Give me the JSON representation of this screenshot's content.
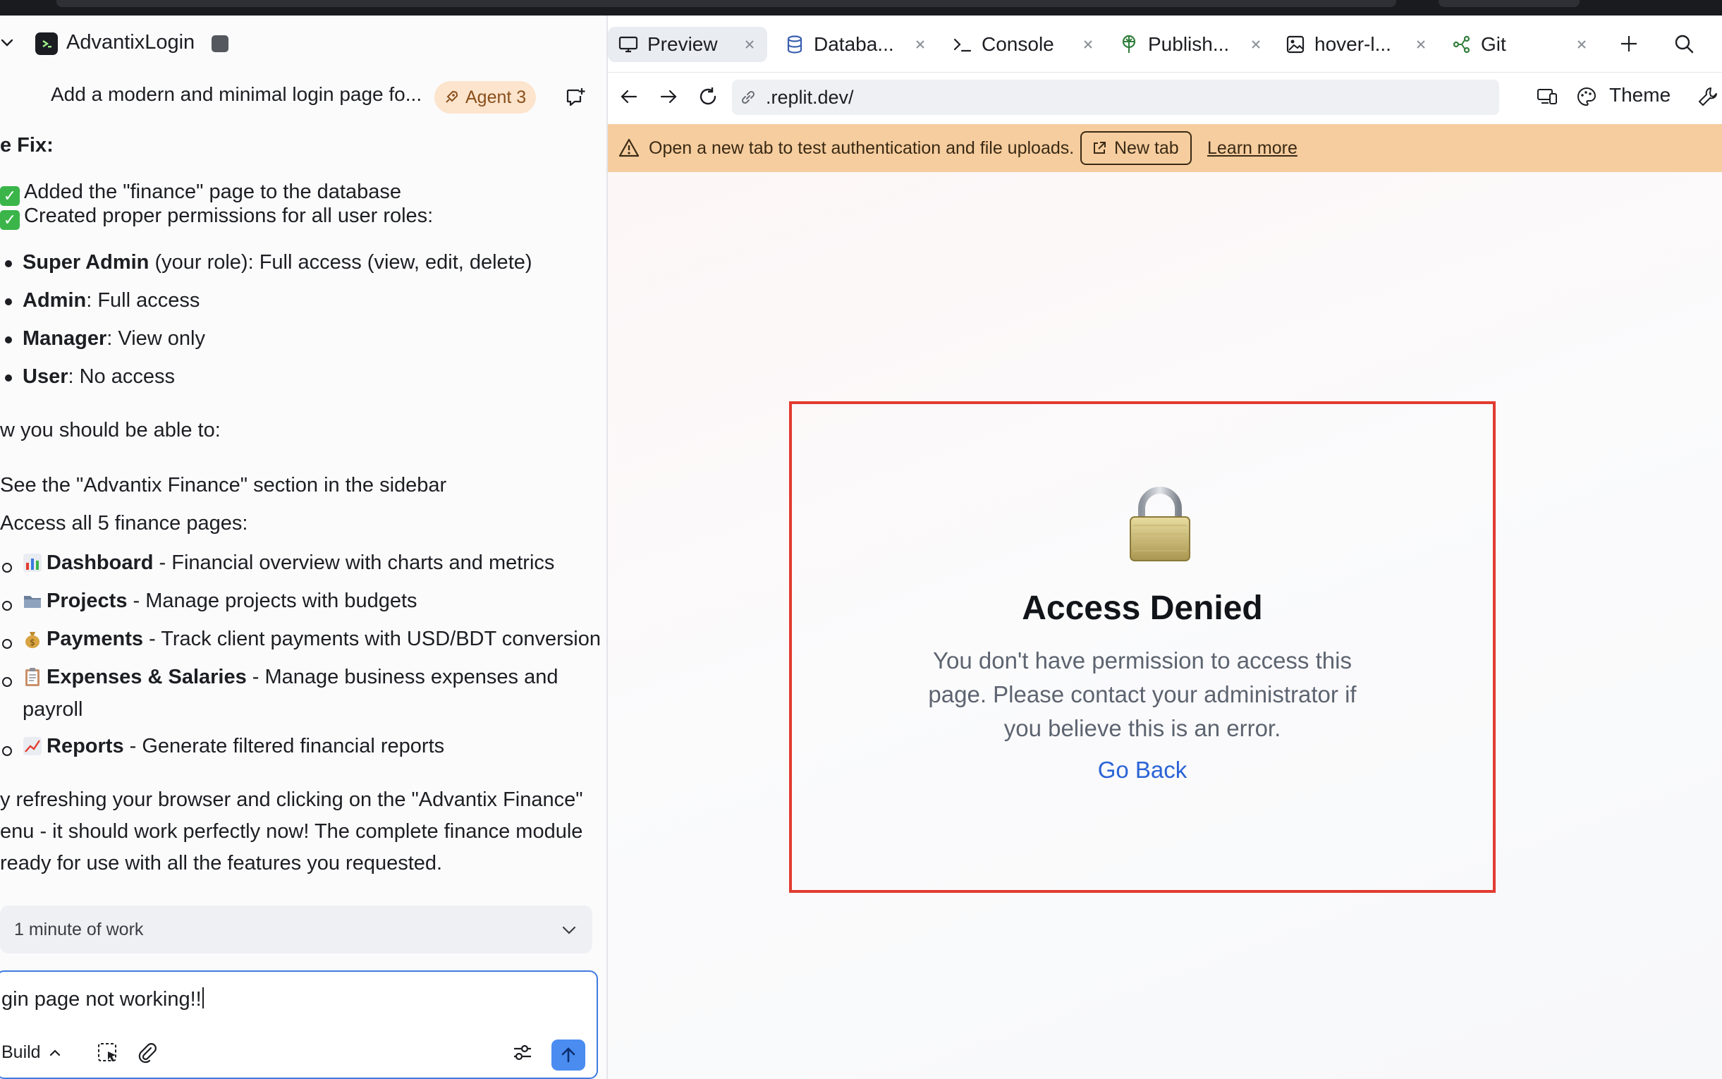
{
  "project": {
    "name": "AdvantixLogin"
  },
  "chat": {
    "title": "Add a modern and minimal login page fo...",
    "agent_badge": "Agent 3",
    "heading_fragment": "e Fix:",
    "fix_items": [
      {
        "text": "Added the \"finance\" page to the database"
      },
      {
        "text": "Created proper permissions for all user roles:"
      }
    ],
    "roles": [
      {
        "name": "Super Admin",
        "rest": " (your role): Full access (view, edit, delete)"
      },
      {
        "name": "Admin",
        "rest": ": Full access"
      },
      {
        "name": "Manager",
        "rest": ": View only"
      },
      {
        "name": "User",
        "rest": ": No access"
      }
    ],
    "now_line": "w you should be able to:",
    "see_line": "See the \"Advantix Finance\" section in the sidebar",
    "access_line": "Access all 5 finance pages:",
    "pages": [
      {
        "icon": "bar-chart-emoji",
        "name": "Dashboard",
        "desc": " - Financial overview with charts and metrics"
      },
      {
        "icon": "folder-emoji",
        "name": "Projects",
        "desc": " - Manage projects with budgets"
      },
      {
        "icon": "money-bag-emoji",
        "name": "Payments",
        "desc": " - Track client payments with USD/BDT conversion"
      },
      {
        "icon": "clipboard-emoji",
        "name": "Expenses & Salaries",
        "desc": " - Manage business expenses and"
      },
      {
        "icon": "chart-up-emoji",
        "name": "Reports",
        "desc": " - Generate filtered financial reports"
      }
    ],
    "payroll_cont": "payroll",
    "closing": [
      "y refreshing your browser and clicking on the \"Advantix Finance\"",
      "enu - it should work perfectly now! The complete finance module",
      "ready for use with all the features you requested."
    ],
    "work_summary": "1 minute of work",
    "input_value": "gin page not working!!",
    "mode_label": "Build"
  },
  "tabs": [
    {
      "label": "Preview",
      "icon": "monitor-icon",
      "active": true
    },
    {
      "label": "Databa...",
      "icon": "database-icon"
    },
    {
      "label": "Console",
      "icon": "terminal-icon"
    },
    {
      "label": "Publish...",
      "icon": "publish-icon"
    },
    {
      "label": "hover-l...",
      "icon": "image-icon"
    },
    {
      "label": "Git",
      "icon": "git-icon"
    }
  ],
  "address": {
    "url": ".replit.dev/",
    "theme_label": "Theme"
  },
  "banner": {
    "message": "Open a new tab to test authentication and file uploads.",
    "new_tab": "New tab",
    "learn_more": "Learn more"
  },
  "page": {
    "title": "Access Denied",
    "message": "You don't have permission to access this page. Please contact your administrator if you believe this is an error.",
    "go_back": "Go Back"
  },
  "colors": {
    "accent_blue": "#4a8cf0",
    "banner_bg": "#f6cd9f",
    "highlight_red": "#e23b30",
    "link_blue": "#2b63d6"
  }
}
